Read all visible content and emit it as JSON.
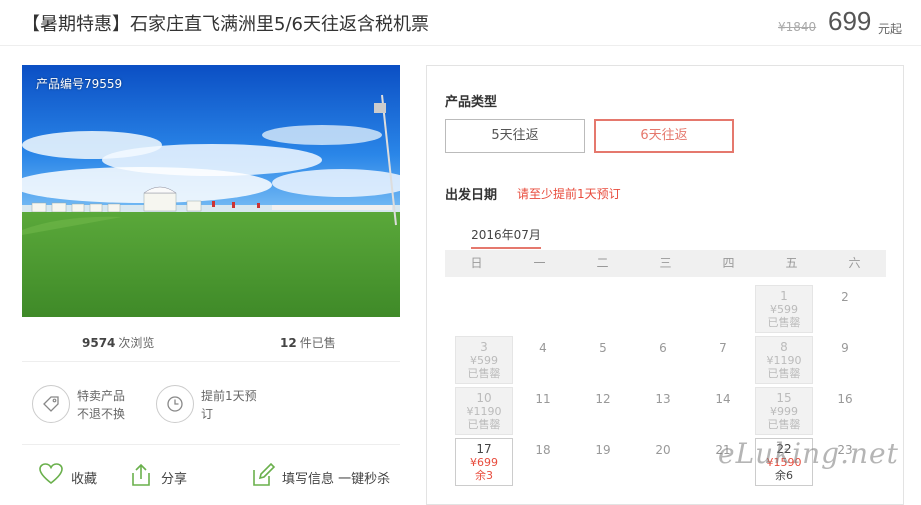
{
  "header": {
    "title": "【暑期特惠】石家庄直飞满洲里5/6天往返含税机票",
    "original_price": "¥1840",
    "price": "699",
    "price_unit": "元起"
  },
  "photo": {
    "code": "产品编号79559"
  },
  "stats": {
    "views_num": "9574",
    "views_label": "次浏览",
    "sold_num": "12",
    "sold_label": "件已售"
  },
  "features": [
    {
      "line1": "特卖产品",
      "line2": "不退不换"
    },
    {
      "line1": "提前1天预",
      "line2": "订"
    }
  ],
  "actions": {
    "favorite": "收藏",
    "share": "分享",
    "fill": "填写信息 一键秒杀"
  },
  "panel": {
    "type_label": "产品类型",
    "types": [
      "5天往返",
      "6天往返"
    ],
    "selected_type": "6天往返",
    "date_label": "出发日期",
    "date_hint": "请至少提前1天预订",
    "month": "2016年07月",
    "weekdays": [
      "日",
      "一",
      "二",
      "三",
      "四",
      "五",
      "六"
    ],
    "days": {
      "d1": {
        "num": "1",
        "price": "¥599",
        "status": "已售罄"
      },
      "d2": {
        "num": "2"
      },
      "d3": {
        "num": "3",
        "price": "¥599",
        "status": "已售罄"
      },
      "d4": {
        "num": "4"
      },
      "d5": {
        "num": "5"
      },
      "d6": {
        "num": "6"
      },
      "d7": {
        "num": "7"
      },
      "d8": {
        "num": "8",
        "price": "¥1190",
        "status": "已售罄"
      },
      "d9": {
        "num": "9"
      },
      "d10": {
        "num": "10",
        "price": "¥1190",
        "status": "已售罄"
      },
      "d11": {
        "num": "11"
      },
      "d12": {
        "num": "12"
      },
      "d13": {
        "num": "13"
      },
      "d14": {
        "num": "14"
      },
      "d15": {
        "num": "15",
        "price": "¥999",
        "status": "已售罄"
      },
      "d16": {
        "num": "16"
      },
      "d17": {
        "num": "17",
        "price": "¥699",
        "status": "余3"
      },
      "d18": {
        "num": "18"
      },
      "d19": {
        "num": "19"
      },
      "d20": {
        "num": "20"
      },
      "d21": {
        "num": "21"
      },
      "d22": {
        "num": "22",
        "price": "¥1590",
        "status": "余6"
      },
      "d23": {
        "num": "23"
      }
    }
  },
  "watermark": "eLuking.net",
  "colors": {
    "accent": "#e5786d",
    "price_red": "#e84c3d",
    "sky": "#1a66d6",
    "grass": "#4f9a32"
  }
}
